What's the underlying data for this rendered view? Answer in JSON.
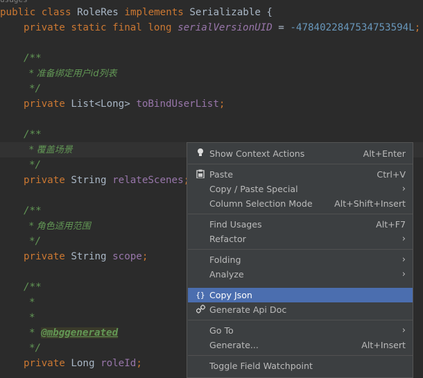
{
  "editor": {
    "top_partial": "usages",
    "line1": {
      "public": "public",
      "class": "class",
      "name": "RoleRes",
      "implements": "implements",
      "iface": "Serializable",
      "brace": "{"
    },
    "line2": {
      "mods": "private static final long",
      "field": "serialVersionUID",
      "eq": " = ",
      "value": "-4784022847534753594L",
      "semi": ";"
    },
    "javadoc_open": "/**",
    "javadoc_close": "*/",
    "comment1": "* 准备绑定用户id列表",
    "decl1": {
      "mod": "private",
      "type": "List<Long>",
      "name": "toBindUserList",
      "semi": ";"
    },
    "comment2": "* 覆盖场景",
    "decl2": {
      "mod": "private",
      "type": "String",
      "name": "relateScenes",
      "semi": ";"
    },
    "comment3": "* 角色适用范围",
    "decl3": {
      "mod": "private",
      "type": "String",
      "name": "scope",
      "semi": ";"
    },
    "star": "*",
    "star_tag_prefix": "* ",
    "tag": "@mbggenerated",
    "decl4": {
      "mod": "private",
      "type": "Long",
      "name": "roleId",
      "semi": ";"
    }
  },
  "context_menu": {
    "show_context_actions": {
      "label": "Show Context Actions",
      "shortcut": "Alt+Enter"
    },
    "paste": {
      "label": "Paste",
      "shortcut": "Ctrl+V"
    },
    "copy_paste_special": {
      "label": "Copy / Paste Special"
    },
    "column_selection_mode": {
      "label": "Column Selection Mode",
      "shortcut": "Alt+Shift+Insert"
    },
    "find_usages": {
      "label": "Find Usages",
      "shortcut": "Alt+F7"
    },
    "refactor": {
      "label": "Refactor"
    },
    "folding": {
      "label": "Folding"
    },
    "analyze": {
      "label": "Analyze"
    },
    "copy_json": {
      "label": "Copy Json"
    },
    "generate_api_doc": {
      "label": "Generate Api Doc"
    },
    "go_to": {
      "label": "Go To"
    },
    "generate": {
      "label": "Generate...",
      "shortcut": "Alt+Insert"
    },
    "toggle_field_watchpoint": {
      "label": "Toggle Field Watchpoint"
    }
  },
  "colors": {
    "editor_bg": "#2b2b2b",
    "keyword": "#cc7832",
    "field": "#9876aa",
    "number": "#6897bb",
    "comment": "#629755",
    "menu_bg": "#3c3f41",
    "menu_selected": "#4b6eaf"
  },
  "icons": {
    "show_context_actions": "lightbulb-icon",
    "paste": "clipboard-icon",
    "copy_json": "braces-icon",
    "generate_api_doc": "link-icon",
    "submenu": "chevron-right-icon"
  }
}
